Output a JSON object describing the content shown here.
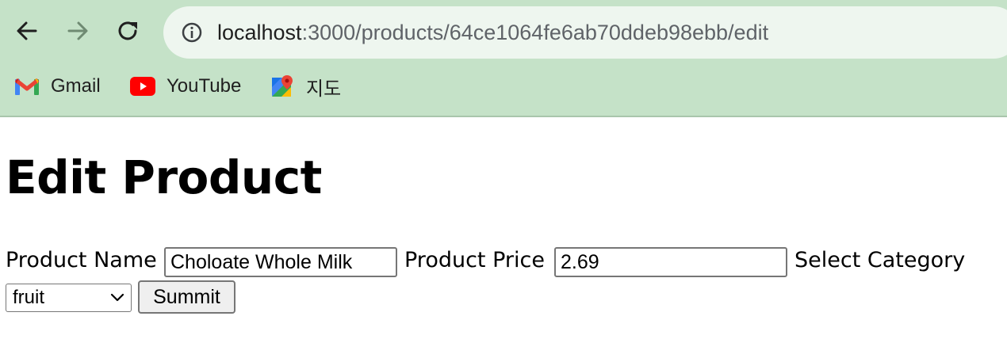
{
  "browser": {
    "url_host": "localhost",
    "url_rest": ":3000/products/64ce1064fe6ab70ddeb98ebb/edit",
    "bookmarks": [
      {
        "label": "Gmail",
        "icon": "gmail-icon"
      },
      {
        "label": "YouTube",
        "icon": "youtube-icon"
      },
      {
        "label": "지도",
        "icon": "google-maps-icon"
      }
    ],
    "colors": {
      "toolbar": "#c5e2c8",
      "omnibox": "#eef6ef"
    }
  },
  "page": {
    "title": "Edit Product",
    "form": {
      "name_label": "Product Name",
      "name_value": "Choloate Whole Milk",
      "price_label": "Product Price",
      "price_value": "2.69",
      "category_label": "Select Category",
      "category_value": "fruit",
      "submit_label": "Summit"
    }
  }
}
